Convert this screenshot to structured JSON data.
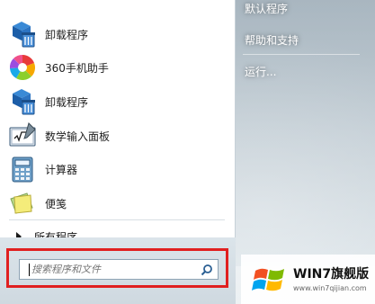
{
  "programs": [
    {
      "label": "卸载程序",
      "icon": "uninstall-icon"
    },
    {
      "label": "360手机助手",
      "icon": "360-phone-assistant-icon"
    },
    {
      "label": "卸载程序",
      "icon": "uninstall-icon"
    },
    {
      "label": "数学输入面板",
      "icon": "math-input-panel-icon"
    },
    {
      "label": "计算器",
      "icon": "calculator-icon"
    },
    {
      "label": "便笺",
      "icon": "sticky-notes-icon"
    }
  ],
  "all_programs_label": "所有程序",
  "right_menu": {
    "default_programs": "默认程序",
    "help_support": "帮助和支持",
    "run": "运行..."
  },
  "search": {
    "placeholder": "搜索程序和文件"
  },
  "watermark": {
    "title": "WIN7旗舰版",
    "url": "www.win7qijian.com"
  },
  "colors": {
    "highlight": "#e02020",
    "accent": "#1f6fb8"
  }
}
